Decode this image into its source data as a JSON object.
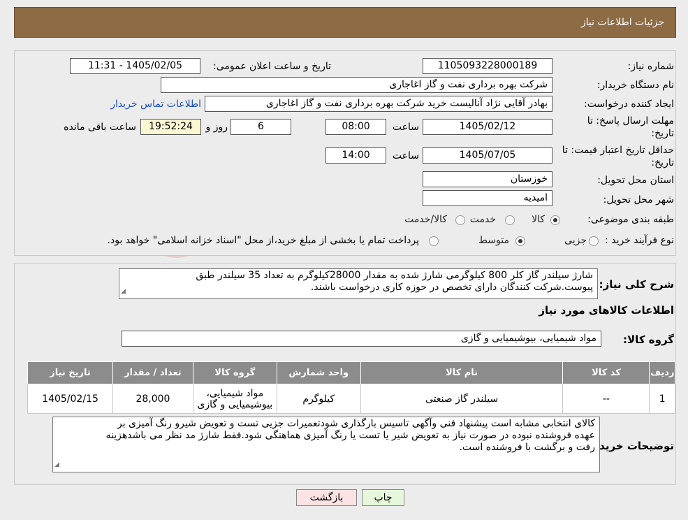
{
  "header": {
    "title": "جزئیات اطلاعات نیاز"
  },
  "fields": {
    "need_number_label": "شماره نیاز:",
    "need_number": "1105093228000189",
    "announce_label": "تاریخ و ساعت اعلان عمومی:",
    "announce_value": "1405/02/05 - 11:31",
    "buyer_org_label": "نام دستگاه خریدار:",
    "buyer_org": "شرکت بهره برداری نفت و گاز اغاجاری",
    "creator_label": "ایجاد کننده درخواست:",
    "creator": "بهادر  آقایی نژاد آنالیست خرید شرکت بهره برداری نفت و گاز اغاجاری",
    "buyer_contact_link": "اطلاعات تماس خریدار",
    "deadline_label_1": "مهلت ارسال پاسخ: تا",
    "deadline_label_2": "تاریخ:",
    "deadline_date": "1405/02/12",
    "hour_label": "ساعت",
    "deadline_time": "08:00",
    "days_value": "6",
    "days_label": "روز و",
    "remaining_time": "19:52:24",
    "remaining_label": "ساعت باقی مانده",
    "validity_label_1": "حداقل تاریخ اعتبار قیمت: تا",
    "validity_label_2": "تاریخ:",
    "validity_date": "1405/07/05",
    "validity_hour_label": "ساعت",
    "validity_time": "14:00",
    "province_label": "استان محل تحویل:",
    "province": "خوزستان",
    "city_label": "شهر محل تحویل:",
    "city": "امیدیه",
    "category_label": "طبقه بندی موضوعی:",
    "category_options": [
      "کالا",
      "خدمت",
      "کالا/خدمت"
    ],
    "process_label": "نوع فرآیند خرید :",
    "process_options": [
      "جزیی",
      "متوسط"
    ],
    "process_note": "پرداخت تمام یا بخشی از مبلغ خرید،از محل \"اسناد خزانه اسلامی\" خواهد بود."
  },
  "details": {
    "summary_label": "شرح کلی نیاز:",
    "summary_line1": "شارژ سیلندر گاز کلر 800 کیلوگرمی شارژ شده به مقدار 28000کیلوگرم به تعداد 35 سیلندر طبق",
    "summary_line2": "پیوست.شرکت کنندگان دارای تخصص در حوزه کاری درخواست باشند.",
    "goods_info_title": "اطلاعات کالاهای مورد نیاز",
    "goods_group_label": "گروه کالا:",
    "goods_group": "مواد شیمیایی، بیوشیمیایی و  گازی"
  },
  "table": {
    "headers": [
      "ردیف",
      "کد کالا",
      "نام کالا",
      "واحد شمارش",
      "گروه کالا",
      "تعداد / مقدار",
      "تاریخ نیاز"
    ],
    "rows": [
      {
        "row": "1",
        "code": "--",
        "name": "سیلندر گاز صنعتی",
        "unit": "کیلوگرم",
        "group_line1": "مواد شیمیایی،",
        "group_line2": "بیوشیمیایی و گازی",
        "quantity": "28,000",
        "date": "1405/02/15"
      }
    ]
  },
  "buyer_notes": {
    "label": "توضیحات خریدار:",
    "line1": "کالای انتخابی مشابه است پیشنهاد فنی وآگهی تاسیس بارگذاری شودتعمیرات جزیی  تست و تعویض شیرو رنگ آمیزی بر",
    "line2": "عهده فروشنده نبوده در صورت نیاز به تعویض شیر یا تست یا رنگ آمیزی هماهنگی شود.فقط شارژ مد نظر می باشدهزینه",
    "line3": "رفت و برگشت با فروشنده است."
  },
  "buttons": {
    "print": "چاپ",
    "back": "بازگشت"
  },
  "colors": {
    "header": "#8d6b45",
    "table_header": "#8c8c8c",
    "print_btn": "#e6f7dc",
    "back_btn": "#fbe3e3"
  }
}
